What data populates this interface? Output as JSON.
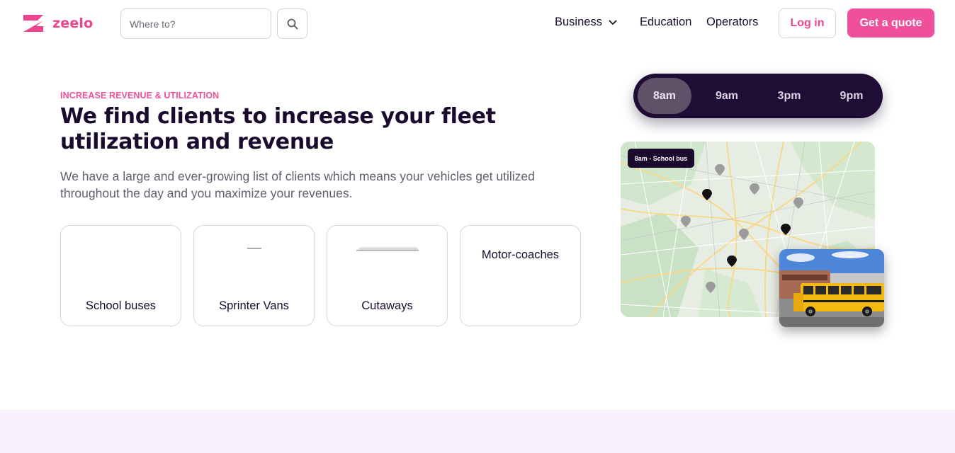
{
  "brand": {
    "name": "zeelo",
    "logo_icon": "zeelo-z-logo",
    "accent": "#f0509a",
    "dark": "#1a0b2e"
  },
  "header": {
    "search": {
      "placeholder": "Where to?",
      "value": "",
      "icon": "search-icon"
    },
    "nav": {
      "business": "Business",
      "education": "Education",
      "operators": "Operators"
    },
    "login_label": "Log in",
    "quote_label": "Get a quote"
  },
  "hero": {
    "eyebrow": "INCREASE REVENUE & UTILIZATION",
    "headline": "We find clients to increase your fleet utilization and revenue",
    "description": "We have a large and ever-growing list of clients which means your vehicles get utilized throughout the day and you maximize your revenues.",
    "vehicles": [
      {
        "label": "School buses"
      },
      {
        "label": "Sprinter Vans"
      },
      {
        "label": "Cutaways"
      },
      {
        "label": "Motor-coaches"
      }
    ]
  },
  "schedule": {
    "times": [
      "8am",
      "9am",
      "3pm",
      "9pm"
    ],
    "selected": "8am",
    "map_label": "8am - School bus"
  }
}
